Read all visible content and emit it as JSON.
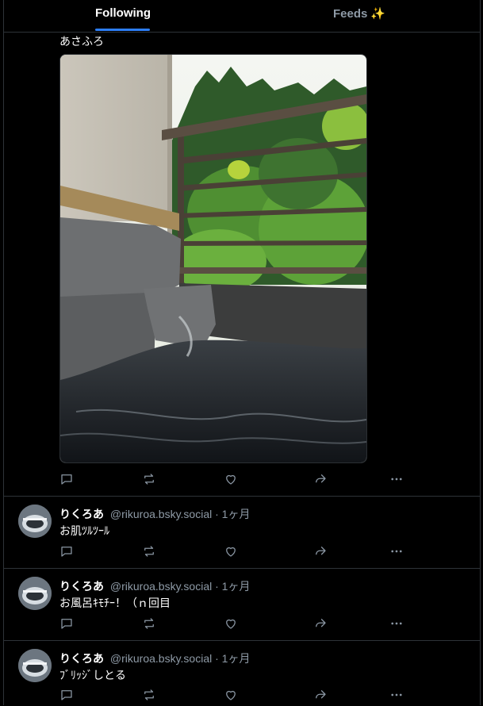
{
  "tabs": {
    "following": "Following",
    "feeds": "Feeds",
    "feeds_icon": "sparkle-icon"
  },
  "top_post": {
    "text": "あさふろ",
    "image_alt": "open-air bath overlooking green trees"
  },
  "posts": [
    {
      "name": "りくろあ",
      "handle": "@rikuroa.bsky.social",
      "sep": "·",
      "age": "1ヶ月",
      "text": "お肌ﾂﾙﾂｰﾙ"
    },
    {
      "name": "りくろあ",
      "handle": "@rikuroa.bsky.social",
      "sep": "·",
      "age": "1ヶ月",
      "text": "お風呂ｷﾓﾁｰ！（ｎ回目"
    },
    {
      "name": "りくろあ",
      "handle": "@rikuroa.bsky.social",
      "sep": "·",
      "age": "1ヶ月",
      "text": "ﾌﾞﾘｯｼﾞしとる"
    }
  ],
  "colors": {
    "accent": "#2d7ef7",
    "muted": "#8e9aa6",
    "border": "#2e3338",
    "background": "#000000"
  }
}
